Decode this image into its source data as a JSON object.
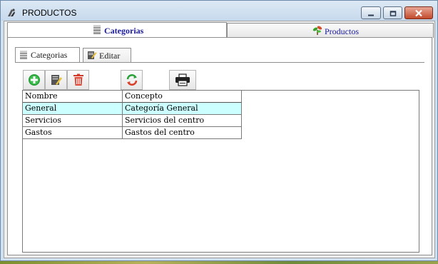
{
  "window": {
    "title": "PRODUCTOS",
    "controls": {
      "minimize": "minimize",
      "maximize": "maximize",
      "close": "close"
    }
  },
  "outer_tabs": [
    {
      "label": "Categorias",
      "icon": "database-icon",
      "active": true
    },
    {
      "label": "Productos",
      "icon": "plant-icon",
      "active": false
    }
  ],
  "inner_tabs": [
    {
      "label": "Categorias",
      "icon": "database-icon",
      "active": true
    },
    {
      "label": "Editar",
      "icon": "edit-icon",
      "active": false
    }
  ],
  "toolbar": [
    {
      "name": "add",
      "icon": "add-icon"
    },
    {
      "name": "edit",
      "icon": "edit-icon"
    },
    {
      "name": "delete",
      "icon": "trash-icon"
    },
    {
      "name": "refresh",
      "icon": "refresh-icon"
    },
    {
      "name": "print",
      "icon": "print-icon"
    }
  ],
  "grid": {
    "columns": [
      "Nombre",
      "Concepto"
    ],
    "rows": [
      [
        "General",
        "Categoría General"
      ],
      [
        "Servicios",
        "Servicios del centro"
      ],
      [
        "Gastos",
        "Gastos del centro"
      ]
    ],
    "selected_row": 0,
    "selected_color": "#ccffff"
  }
}
